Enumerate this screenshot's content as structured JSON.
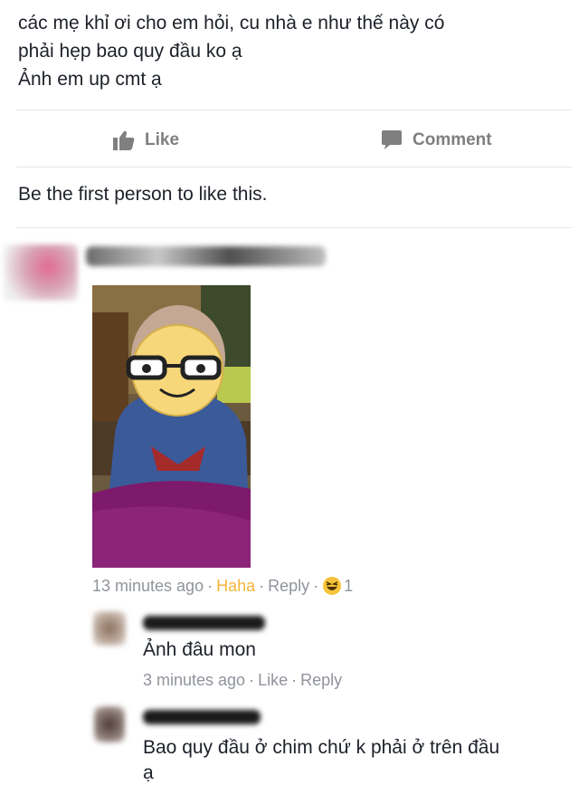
{
  "post": {
    "lines": [
      "các mẹ khỉ ơi cho em hỏi, cu nhà e như thế này có",
      "phải hẹp bao quy đầu ko ạ",
      "Ảnh em up cmt ạ"
    ]
  },
  "actions": {
    "like_label": "Like",
    "comment_label": "Comment"
  },
  "likes_summary": "Be the first person to like this.",
  "comments": [
    {
      "time": "13 minutes ago",
      "reaction_link": "Haha",
      "reply_label": "Reply",
      "reaction_count": "1"
    }
  ],
  "replies": [
    {
      "text": "Ảnh đâu mon",
      "time": "3 minutes ago",
      "like_label": "Like",
      "reply_label": "Reply"
    },
    {
      "text_line1": "Bao quy đầu ở chim chứ k phải ở trên đầu",
      "text_line2": "ạ"
    }
  ],
  "colors": {
    "text": "#1d2129",
    "meta": "#90949c",
    "haha": "#f3b53b",
    "action": "#7f7f7f"
  }
}
